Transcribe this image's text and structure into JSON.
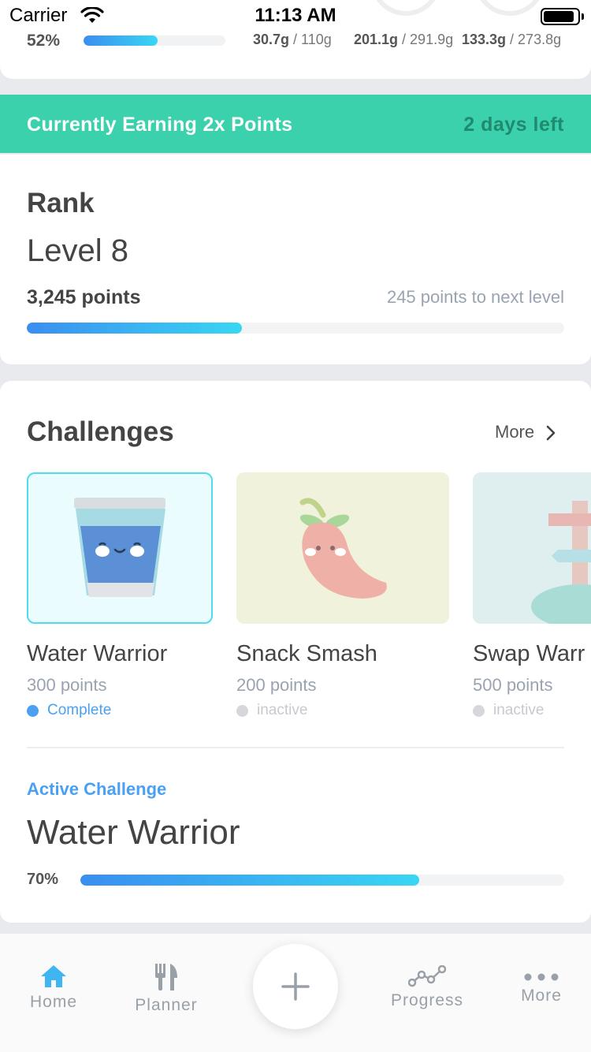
{
  "status_bar": {
    "carrier": "Carrier",
    "time": "11:13 AM"
  },
  "summary": {
    "calories_pct": "52%",
    "calories_progress": 0.52,
    "macros": [
      {
        "value": "30.7g",
        "goal": " / 110g"
      },
      {
        "value": "201.1g",
        "goal": " / 291.9g"
      },
      {
        "value": "133.3g",
        "goal": " / 273.8g"
      }
    ]
  },
  "banner": {
    "text": "Currently Earning 2x Points",
    "days_left": "2 days left",
    "color": "#3cd1ad"
  },
  "rank": {
    "title": "Rank",
    "level": "Level 8",
    "points": "3,245 points",
    "next_level": "245 points to next level",
    "progress": 0.4
  },
  "challenges": {
    "title": "Challenges",
    "more_label": "More",
    "items": [
      {
        "name": "Water Warrior",
        "points": "300 points",
        "status": "Complete",
        "status_color": "#4aa0f2",
        "icon": "water-glass-icon"
      },
      {
        "name": "Snack Smash",
        "points": "200 points",
        "status": "inactive",
        "status_color": "#d5d7da",
        "icon": "chili-pepper-icon"
      },
      {
        "name": "Swap Warr",
        "points": "500 points",
        "status": "inactive",
        "status_color": "#d5d7da",
        "icon": "signpost-icon"
      }
    ],
    "active": {
      "label": "Active Challenge",
      "name": "Water Warrior",
      "pct": "70%",
      "progress": 0.7
    }
  },
  "tabbar": {
    "home": "Home",
    "planner": "Planner",
    "progress": "Progress",
    "more": "More",
    "accent": "#3fb6f2"
  }
}
